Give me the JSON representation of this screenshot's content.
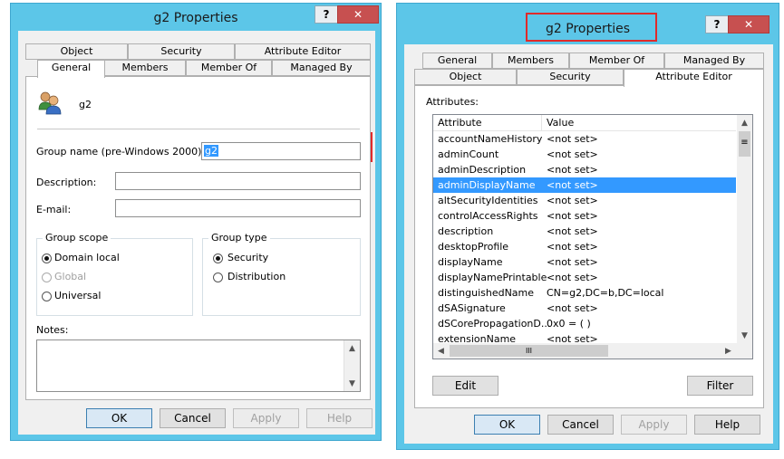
{
  "left": {
    "title": "g2 Properties",
    "help": "?",
    "close": "✕",
    "tabs_top": [
      "Object",
      "Security",
      "Attribute Editor"
    ],
    "tabs_bottom": [
      "General",
      "Members",
      "Member Of",
      "Managed By"
    ],
    "object_name": "g2",
    "group_name_label": "Group name (pre-Windows 2000):",
    "group_name_value": "g2",
    "description_label": "Description:",
    "email_label": "E-mail:",
    "scope_title": "Group scope",
    "scope_options": [
      "Domain local",
      "Global",
      "Universal"
    ],
    "type_title": "Group type",
    "type_options": [
      "Security",
      "Distribution"
    ],
    "notes_label": "Notes:",
    "buttons": [
      "OK",
      "Cancel",
      "Apply",
      "Help"
    ]
  },
  "right": {
    "title": "g2 Properties",
    "help": "?",
    "close": "✕",
    "tabs_top": [
      "General",
      "Members",
      "Member Of",
      "Managed By"
    ],
    "tabs_bottom": [
      "Object",
      "Security",
      "Attribute Editor"
    ],
    "attributes_label": "Attributes:",
    "col_attr": "Attribute",
    "col_value": "Value",
    "rows": [
      {
        "a": "accountNameHistory",
        "v": "<not set>"
      },
      {
        "a": "adminCount",
        "v": "<not set>"
      },
      {
        "a": "adminDescription",
        "v": "<not set>"
      },
      {
        "a": "adminDisplayName",
        "v": "<not set>"
      },
      {
        "a": "altSecurityIdentities",
        "v": "<not set>"
      },
      {
        "a": "controlAccessRights",
        "v": "<not set>"
      },
      {
        "a": "description",
        "v": "<not set>"
      },
      {
        "a": "desktopProfile",
        "v": "<not set>"
      },
      {
        "a": "displayName",
        "v": "<not set>"
      },
      {
        "a": "displayNamePrintable",
        "v": "<not set>"
      },
      {
        "a": "distinguishedName",
        "v": "CN=g2,DC=b,DC=local"
      },
      {
        "a": "dSASignature",
        "v": "<not set>"
      },
      {
        "a": "dSCorePropagationD...",
        "v": "0x0 = ( )"
      },
      {
        "a": "extensionName",
        "v": "<not set>"
      }
    ],
    "edit": "Edit",
    "filter": "Filter",
    "hscroll_grip": "III",
    "buttons": [
      "OK",
      "Cancel",
      "Apply",
      "Help"
    ]
  }
}
